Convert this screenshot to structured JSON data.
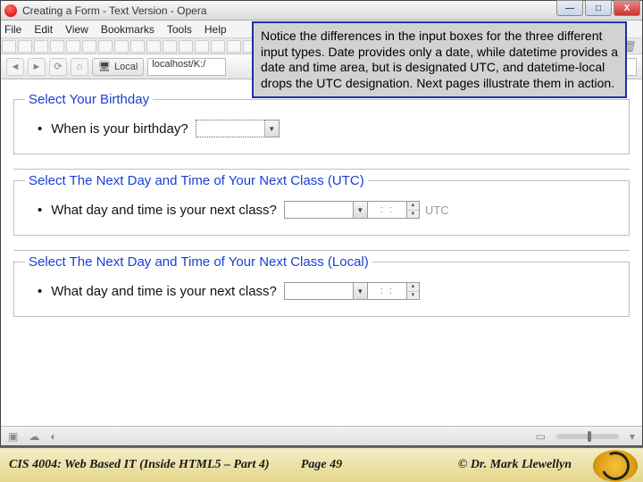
{
  "window": {
    "title": "Creating a Form - Text Version - Opera",
    "min_glyph": "—",
    "max_glyph": "□",
    "close_glyph": "X"
  },
  "menu": {
    "file": "File",
    "edit": "Edit",
    "view": "View",
    "bookmarks": "Bookmarks",
    "tools": "Tools",
    "help": "Help"
  },
  "toolbar": {
    "badge": "Local",
    "address": "localhost/K:/",
    "search_placeholder": "e"
  },
  "callout": {
    "text": "Notice the differences in the input boxes for the three different input types.  Date provides only a date, while datetime provides a date and time area, but is designated UTC, and datetime-local drops the UTC designation.  Next pages illustrate them in action."
  },
  "form": {
    "fs1": {
      "legend": "Select Your Birthday",
      "label": "When is your birthday?"
    },
    "fs2": {
      "legend": "Select The Next Day and Time of Your Next Class (UTC)",
      "label": "What day and time is your next class?",
      "time_placeholder": ":    :",
      "utc": "UTC"
    },
    "fs3": {
      "legend": "Select The Next Day and Time of Your Next Class (Local)",
      "label": "What day and time is your next class?",
      "time_placeholder": ":    :"
    }
  },
  "footer": {
    "course": "CIS 4004: Web Based IT (Inside HTML5 – Part 4)",
    "page": "Page 49",
    "author": "© Dr. Mark Llewellyn"
  }
}
